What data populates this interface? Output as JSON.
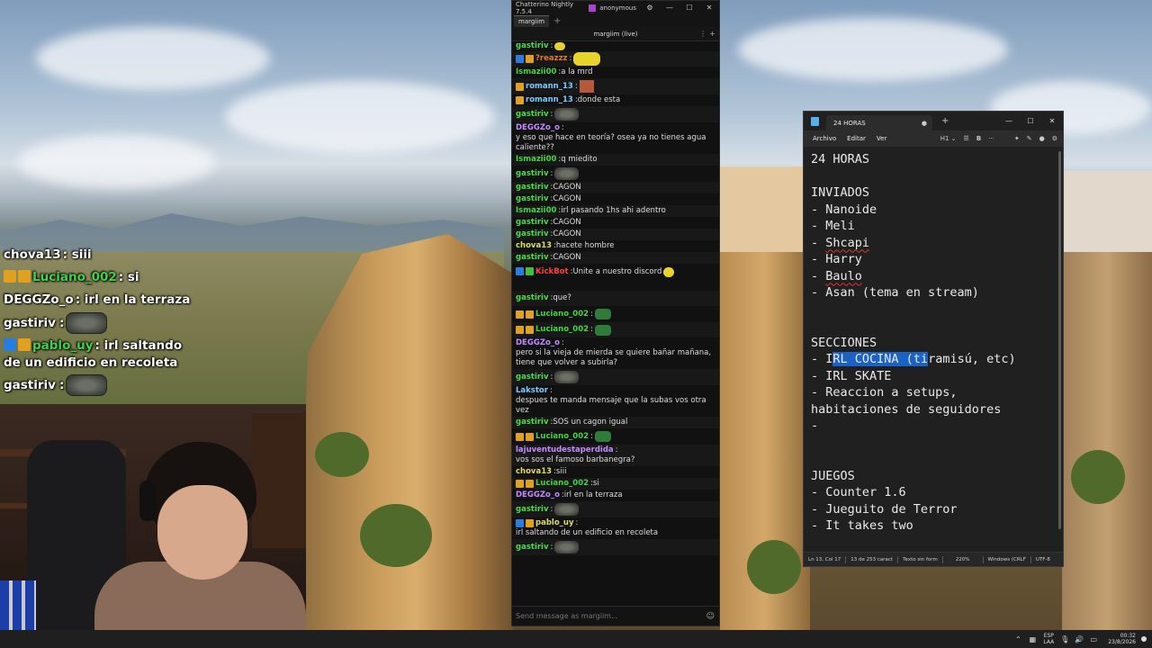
{
  "overlay_chat": {
    "lines": [
      {
        "user": "chova13",
        "color": "#ffffff",
        "text": "siii"
      },
      {
        "user": "Luciano_002",
        "color": "#3fd24a",
        "text": "si",
        "badges": [
          "#e0a020",
          "#e0a020"
        ]
      },
      {
        "user": "DEGGZo_o",
        "color": "#ffffff",
        "text": "irl en la terraza"
      },
      {
        "user": "gastiriv",
        "color": "#ffffff",
        "emote": true
      },
      {
        "user": "pablo_uy",
        "color": "#3fd24a",
        "text": "irl saltando",
        "badges": [
          "#2a7de0",
          "#e0a020"
        ],
        "text2": "de un edificio en recoleta"
      },
      {
        "user": "gastiriv",
        "color": "#ffffff",
        "emote": true
      }
    ]
  },
  "chatterino": {
    "title": "Chatterino Nightly 7.5.4",
    "account": "anonymous",
    "tab": "margiim",
    "split_title": "margiim (live)",
    "input_placeholder": "Send message as margiim...",
    "messages": [
      {
        "user": "gastiriv",
        "color": "#4ddc4d",
        "emote": "yellow-small"
      },
      {
        "user": "?reazzz",
        "color": "#e07a28",
        "emote": "yellow",
        "badges": [
          "#2a7de0",
          "#e0a020"
        ]
      },
      {
        "user": "Ismazii00",
        "color": "#44d444",
        "text": "a la mrd"
      },
      {
        "user": "romann_13",
        "color": "#7ec8ff",
        "emote": "red",
        "badges": [
          "#e0a020"
        ]
      },
      {
        "user": "romann_13",
        "color": "#7ec8ff",
        "text": "donde esta",
        "badges": [
          "#e0a020"
        ]
      },
      {
        "user": "gastiriv",
        "color": "#4ddc4d",
        "emote": "gray"
      },
      {
        "user": "DEGGZo_o",
        "color": "#c28bff",
        "text": "y eso que hace en teoría? osea ya no tienes agua caliente??"
      },
      {
        "user": "Ismazii00",
        "color": "#44d444",
        "text": "q miedito"
      },
      {
        "user": "gastiriv",
        "color": "#4ddc4d",
        "emote": "gray"
      },
      {
        "user": "gastiriv",
        "color": "#4ddc4d",
        "text": "CAGON"
      },
      {
        "user": "gastiriv",
        "color": "#4ddc4d",
        "text": "CAGON"
      },
      {
        "user": "Ismazii00",
        "color": "#44d444",
        "text": "irl pasando 1hs ahi adentro"
      },
      {
        "user": "gastiriv",
        "color": "#4ddc4d",
        "text": "CAGON"
      },
      {
        "user": "gastiriv",
        "color": "#4ddc4d",
        "text": "CAGON"
      },
      {
        "user": "chova13",
        "color": "#dcdc5a",
        "text": "hacete hombre"
      },
      {
        "user": "gastiriv",
        "color": "#4ddc4d",
        "text": "CAGON"
      },
      {
        "user": "KickBot",
        "color": "#ff4040",
        "text": "Unite a nuestro discord",
        "badges": [
          "#2a7de0",
          "#40c040"
        ],
        "emote": "yellow-small"
      },
      {
        "user": "gastiriv",
        "color": "#4ddc4d",
        "text": "que?"
      },
      {
        "user": "Luciano_002",
        "color": "#44d444",
        "emote": "green",
        "badges": [
          "#e0a020",
          "#e0a020"
        ]
      },
      {
        "user": "Luciano_002",
        "color": "#44d444",
        "emote": "green",
        "badges": [
          "#e0a020",
          "#e0a020"
        ]
      },
      {
        "user": "DEGGZo_o",
        "color": "#c28bff",
        "text": "pero si la vieja de mierda se quiere bañar mañana, tiene que volver a subirla?"
      },
      {
        "user": "gastiriv",
        "color": "#4ddc4d",
        "emote": "gray"
      },
      {
        "user": "Lakstor",
        "color": "#7ec8ff",
        "text": "despues te manda mensaje que la subas vos otra vez"
      },
      {
        "user": "gastiriv",
        "color": "#4ddc4d",
        "text": "SOS un cagon igual"
      },
      {
        "user": "Luciano_002",
        "color": "#44d444",
        "emote": "green",
        "badges": [
          "#e0a020",
          "#e0a020"
        ]
      },
      {
        "user": "lajuventudestaperdida",
        "color": "#c28bff",
        "text": "vos sos el famoso barbanegra?"
      },
      {
        "user": "chova13",
        "color": "#dcdc5a",
        "text": "siii"
      },
      {
        "user": "Luciano_002",
        "color": "#44d444",
        "text": "si",
        "badges": [
          "#e0a020",
          "#e0a020"
        ]
      },
      {
        "user": "DEGGZo_o",
        "color": "#c28bff",
        "text": "irl en la terraza"
      },
      {
        "user": "gastiriv",
        "color": "#4ddc4d",
        "emote": "gray"
      },
      {
        "user": "pablo_uy",
        "color": "#dcdc5a",
        "text": "irl saltando de un edificio en recoleta",
        "badges": [
          "#2a7de0",
          "#e0a020"
        ]
      },
      {
        "user": "gastiriv",
        "color": "#4ddc4d",
        "emote": "gray"
      }
    ]
  },
  "notepad": {
    "tab_title": "24 HORAS",
    "menu": [
      "Archivo",
      "Editar",
      "Ver"
    ],
    "heading_select": "H1",
    "status": {
      "position": "Ln 13, Col 17",
      "chars": "13 de 253 caract",
      "format": "Texto sin form",
      "zoom": "220%",
      "line_ending": "Windows (CRLF",
      "encoding": "UTF-8"
    },
    "lines": {
      "l1": "24 HORAS",
      "l3": "INVIADOS",
      "l4": "- Nanoide",
      "l5": "- Meli",
      "l6a": "- ",
      "l6b": "Shcapi",
      "l7": "- Harry",
      "l8a": "- ",
      "l8b": "Baulo",
      "l9": "- Asan (tema en stream)",
      "l12": "SECCIONES",
      "l13a": "- I",
      "l13b": "RL COCINA (ti",
      "l13c": "ramisú, etc)",
      "l14": "- IRL SKATE",
      "l15": "- Reaccion a setups,",
      "l16": "habitaciones de seguidores",
      "l17": "-",
      "l20": "JUEGOS",
      "l21": "- Counter 1.6",
      "l22": "- Jueguito de Terror",
      "l23": "- It takes two"
    }
  },
  "taskbar": {
    "lang_top": "ESP",
    "lang_bottom": "LAA",
    "time": "00:32",
    "date": "23/8/2026"
  }
}
